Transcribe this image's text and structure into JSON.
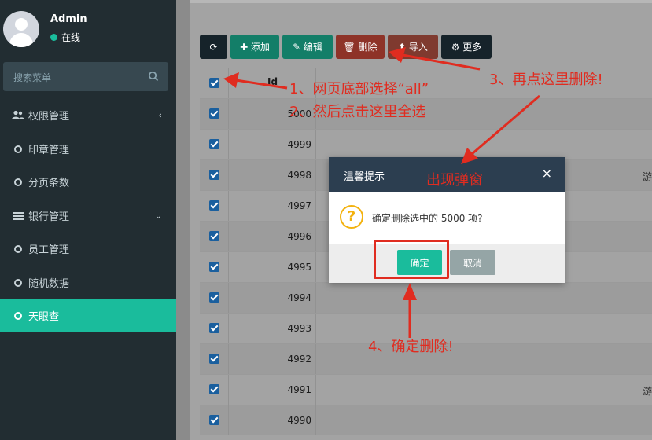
{
  "user": {
    "name": "Admin",
    "status": "在线"
  },
  "search": {
    "placeholder": "搜索菜单"
  },
  "menu": [
    {
      "label": "权限管理",
      "icon": "users-icon",
      "chevron": "‹"
    },
    {
      "label": "印章管理",
      "icon": "circle-icon"
    },
    {
      "label": "分页条数",
      "icon": "circle-icon"
    },
    {
      "label": "银行管理",
      "icon": "list-icon",
      "chevron": "⌄"
    },
    {
      "label": "员工管理",
      "icon": "circle-icon"
    },
    {
      "label": "随机数据",
      "icon": "circle-icon"
    },
    {
      "label": "天眼查",
      "icon": "circle-icon",
      "active": true
    }
  ],
  "toolbar": {
    "refresh_icon": "⟳",
    "add": "✚ 添加",
    "edit": "✎ 编辑",
    "delete": "🗑 删除",
    "import": "⬆ 导入",
    "more": "⚙ 更多"
  },
  "table": {
    "header_id": "Id",
    "rows": [
      "5000",
      "4999",
      "4998",
      "4997",
      "4996",
      "4995",
      "4994",
      "4993",
      "4992",
      "4991",
      "4990"
    ],
    "edge_marks": [
      "",
      "",
      "游",
      "",
      "",
      "",
      "",
      "",
      "",
      "游",
      ""
    ]
  },
  "modal": {
    "title": "温馨提示",
    "close": "×",
    "icon_glyph": "?",
    "message": "确定删除选中的 5000 项?",
    "ok": "确定",
    "cancel": "取消"
  },
  "annotations": {
    "step1": "1、网页底部选择“all”",
    "step2": "2、然后点击这里全选",
    "step3": "3、再点这里删除!",
    "popup": "出现弹窗",
    "step4": "4、确定删除!"
  },
  "colors": {
    "accent": "#1abc9c",
    "sidebar": "#222d32",
    "annotation": "#e02c20"
  }
}
